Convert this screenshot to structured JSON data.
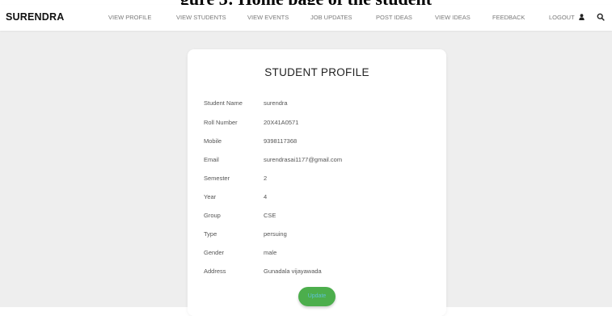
{
  "page_heading": "gure 3: Home page of the student",
  "navbar": {
    "brand": "SURENDRA",
    "links": [
      "VIEW PROFILE",
      "VIEW STUDENTS",
      "VIEW EVENTS",
      "JOB UPDATES",
      "POST IDEAS",
      "VIEW IDEAS",
      "FEEDBACK",
      "LOGOUT"
    ],
    "logout_icon": "user-icon",
    "search_icon": "search-icon"
  },
  "profile": {
    "title": "STUDENT PROFILE",
    "fields": [
      {
        "label": "Student Name",
        "value": "surendra"
      },
      {
        "label": "Roll Number",
        "value": "20X41A0571"
      },
      {
        "label": "Mobile",
        "value": "9398117368"
      },
      {
        "label": "Email",
        "value": "surendrasai1177@gmail.com"
      },
      {
        "label": "Semester",
        "value": "2"
      },
      {
        "label": "Year",
        "value": "4"
      },
      {
        "label": "Group",
        "value": "CSE"
      },
      {
        "label": "Type",
        "value": "persuing"
      },
      {
        "label": "Gender",
        "value": "male"
      },
      {
        "label": "Address",
        "value": "Gunadala vijayawada"
      }
    ],
    "update_label": "Update"
  },
  "colors": {
    "background": "#eeeeee",
    "card": "#ffffff",
    "button": "#4cae4c",
    "button_text": "#5fc1d6",
    "nav_text": "#7a7a7a"
  }
}
